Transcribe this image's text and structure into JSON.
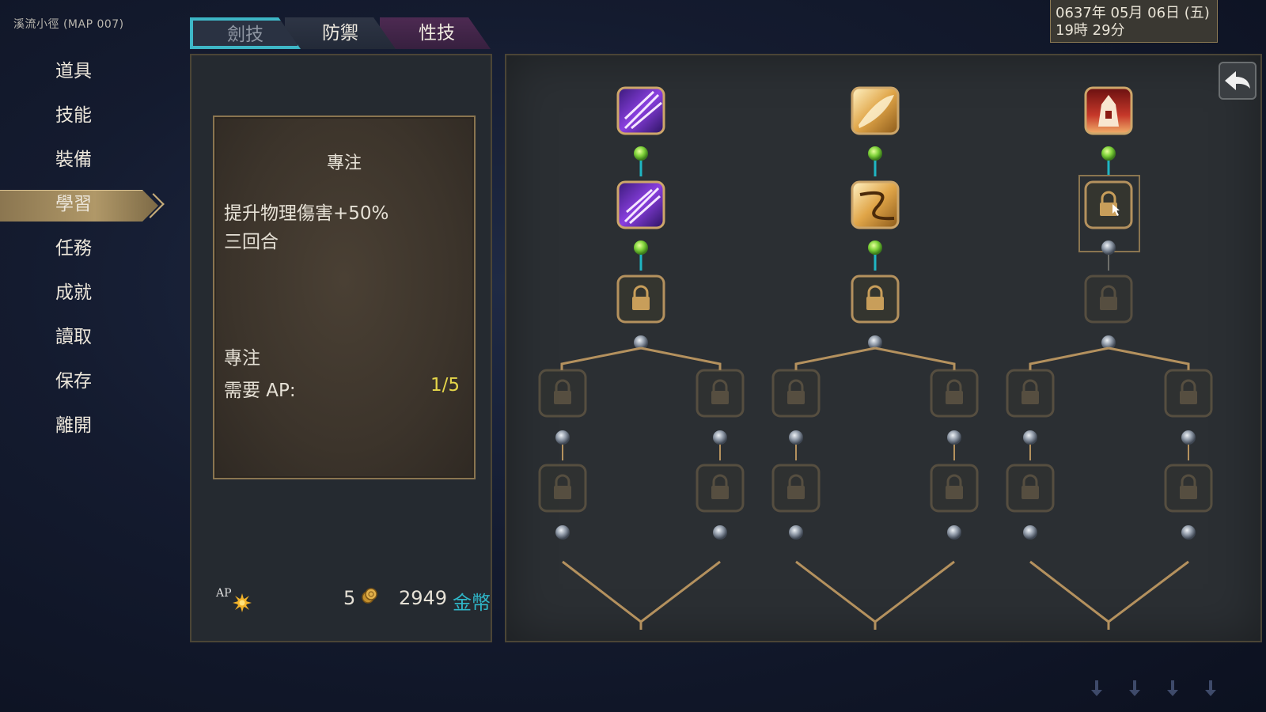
{
  "location": "溪流小徑 (MAP 007)",
  "menu": [
    {
      "label": "道具",
      "active": false
    },
    {
      "label": "技能",
      "active": false
    },
    {
      "label": "裝備",
      "active": false
    },
    {
      "label": "學習",
      "active": true
    },
    {
      "label": "任務",
      "active": false
    },
    {
      "label": "成就",
      "active": false
    },
    {
      "label": "讀取",
      "active": false
    },
    {
      "label": "保存",
      "active": false
    },
    {
      "label": "離開",
      "active": false
    }
  ],
  "tabs": [
    "劍技",
    "防禦",
    "性技"
  ],
  "active_tab": "劍技",
  "skill_info": {
    "title": "專注",
    "description_line1": "提升物理傷害+50%",
    "description_line2": "三回合",
    "name": "專注",
    "ap_label": "需要 AP:",
    "ap_value": "1/5"
  },
  "resources": {
    "ap_label": "AP",
    "ap_count": "5",
    "gold": "2949",
    "gold_unit": "金幣"
  },
  "datetime": {
    "line1": "0637年 05月 06日 (五)",
    "line2": "19時 29分"
  },
  "skill_tree": {
    "columns": [
      {
        "icons": [
          "purple-slash-skill-icon",
          "purple-pierce-skill-icon"
        ],
        "unlocked_levels": 2
      },
      {
        "icons": [
          "gold-sword-skill-icon",
          "gold-spiral-skill-icon"
        ],
        "unlocked_levels": 2
      },
      {
        "icons": [
          "red-tower-skill-icon"
        ],
        "unlocked_levels": 1
      }
    ]
  },
  "colors": {
    "accent_teal": "#2fb7c9",
    "ap_value": "#e5d64a",
    "frame_gold": "#8a7550",
    "connector_active": "#7fd23a",
    "connector_line": "#b4915e"
  }
}
